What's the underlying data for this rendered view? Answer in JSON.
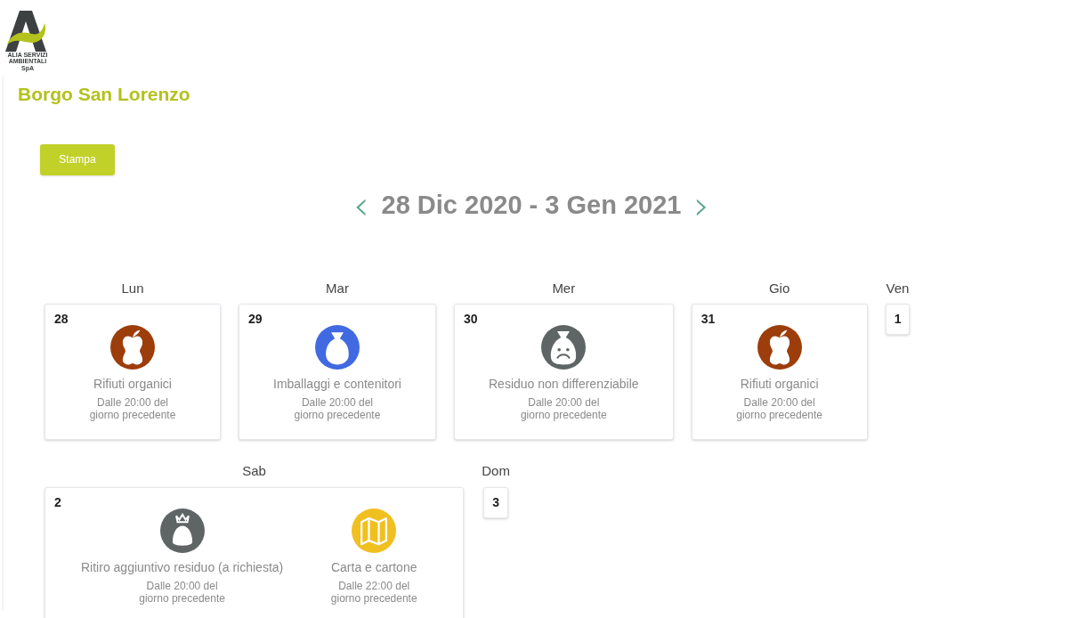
{
  "logo": {
    "lines": [
      "ALIA SERVIZI",
      "AMBIENTALI",
      "SpA"
    ]
  },
  "title": "Borgo San Lorenzo",
  "print_button": "Stampa",
  "week": {
    "prev": "‹",
    "range": "28 Dic 2020 - 3 Gen 2021",
    "next": "›"
  },
  "days": [
    {
      "weekday": "Lun",
      "date": "28",
      "collections": [
        {
          "kind": "organic",
          "name": "Rifiuti organici",
          "time": "Dalle 20:00 del giorno precedente",
          "color": "#9c3d0b"
        }
      ]
    },
    {
      "weekday": "Mar",
      "date": "29",
      "collections": [
        {
          "kind": "packaging",
          "name": "Imballaggi e contenitori",
          "time": "Dalle 20:00 del giorno precedente",
          "color": "#4169e1"
        }
      ]
    },
    {
      "weekday": "Mer",
      "date": "30",
      "collections": [
        {
          "kind": "residual",
          "name": "Residuo non differenziabile",
          "time": "Dalle 20:00 del giorno precedente",
          "color": "#5f6565"
        }
      ]
    },
    {
      "weekday": "Gio",
      "date": "31",
      "collections": [
        {
          "kind": "organic",
          "name": "Rifiuti organici",
          "time": "Dalle 20:00 del giorno precedente",
          "color": "#9c3d0b"
        }
      ]
    },
    {
      "weekday": "Ven",
      "date": "1"
    },
    {
      "weekday": "Sab",
      "date": "2",
      "collections": [
        {
          "kind": "extra",
          "name": "Ritiro aggiuntivo residuo (a richiesta)",
          "time": "Dalle 20:00 del giorno precedente",
          "color": "#5f6565"
        },
        {
          "kind": "paper",
          "name": "Carta e cartone",
          "time": "Dalle 22:00 del giorno precedente",
          "color": "#f0c020"
        }
      ]
    },
    {
      "weekday": "Dom",
      "date": "3"
    }
  ]
}
